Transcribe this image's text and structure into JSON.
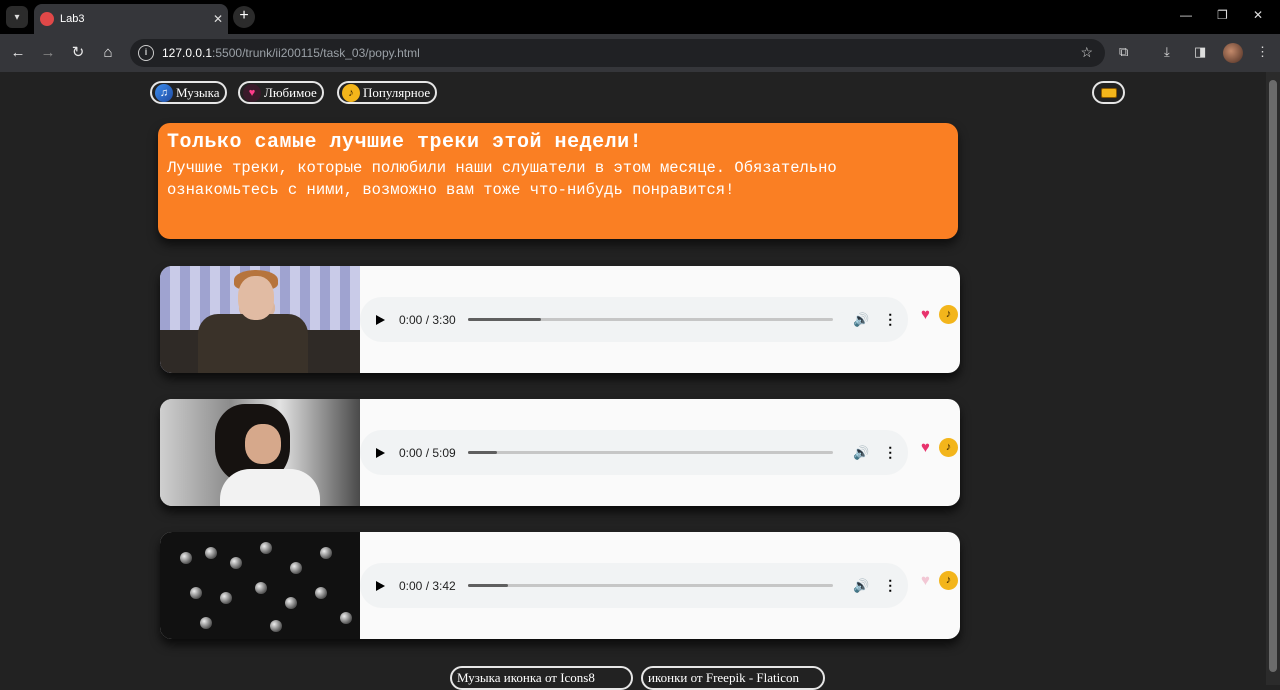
{
  "browser": {
    "tab_title": "Lab3",
    "url_host": "127.0.0.1",
    "url_path": ":5500/trunk/ii200115/task_03/popy.html"
  },
  "nav": {
    "music": "Музыка",
    "favorites": "Любимое",
    "popular": "Популярное"
  },
  "banner": {
    "title": "Только самые лучшие треки этой недели!",
    "text": "Лучшие треки, которые полюбили наши слушатели в этом месяце. Обязательно ознакомьтесь с ними, возможно вам тоже что-нибудь понравится!"
  },
  "tracks": [
    {
      "time": "0:00 / 3:30",
      "progress": 0.2,
      "liked": true
    },
    {
      "time": "0:00 / 5:09",
      "progress": 0.08,
      "liked": true
    },
    {
      "time": "0:00 / 3:42",
      "progress": 0.11,
      "liked": false
    }
  ],
  "footer": {
    "credit1": "Музыка иконка от Icons8",
    "credit2": "иконки от Freepik - Flaticon"
  },
  "colors": {
    "banner": "#fa7f23",
    "background": "#222222",
    "like": "#e8336d",
    "popular": "#f3b51b"
  }
}
